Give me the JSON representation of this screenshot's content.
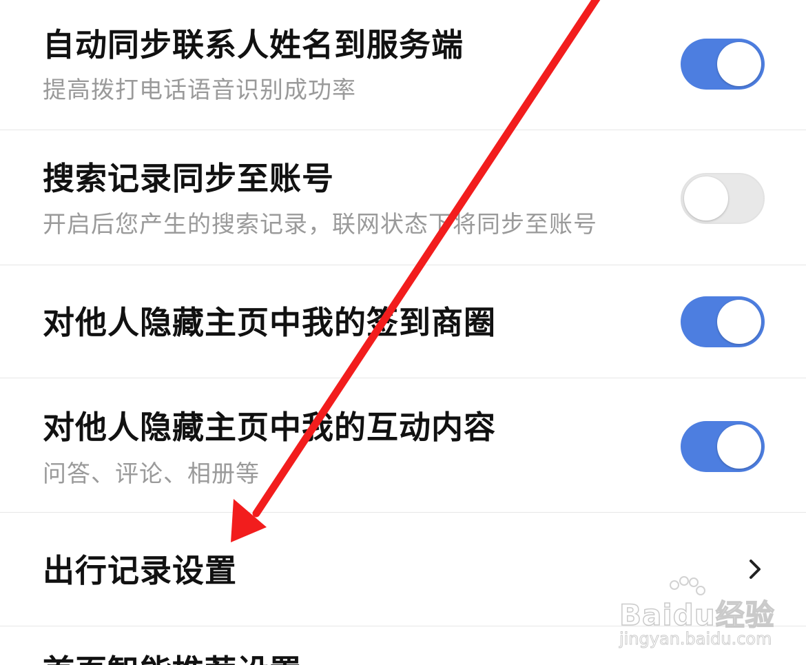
{
  "settings": {
    "items": [
      {
        "title": "自动同步联系人姓名到服务端",
        "subtitle": "提高拨打电话语音识别成功率",
        "control": "toggle",
        "enabled": true
      },
      {
        "title": "搜索记录同步至账号",
        "subtitle": "开启后您产生的搜索记录，联网状态下将同步至账号",
        "control": "toggle",
        "enabled": false
      },
      {
        "title": "对他人隐藏主页中我的签到商圈",
        "subtitle": "",
        "control": "toggle",
        "enabled": true
      },
      {
        "title": "对他人隐藏主页中我的互动内容",
        "subtitle": "问答、评论、相册等",
        "control": "toggle",
        "enabled": true
      },
      {
        "title": "出行记录设置",
        "subtitle": "",
        "control": "chevron-right-icon"
      },
      {
        "title": "首页智能推荐设置",
        "subtitle": "",
        "control": "none"
      }
    ]
  },
  "colors": {
    "toggle_on": "#4d7ee0",
    "toggle_off": "#e8e8e8",
    "annotation_arrow": "#f21d1d",
    "divider": "#e6e6e6"
  },
  "overlay": {
    "annotation": "red-arrow-icon",
    "watermark_logo": "Baidu经验",
    "watermark_url": "jingyan.baidu.com"
  }
}
